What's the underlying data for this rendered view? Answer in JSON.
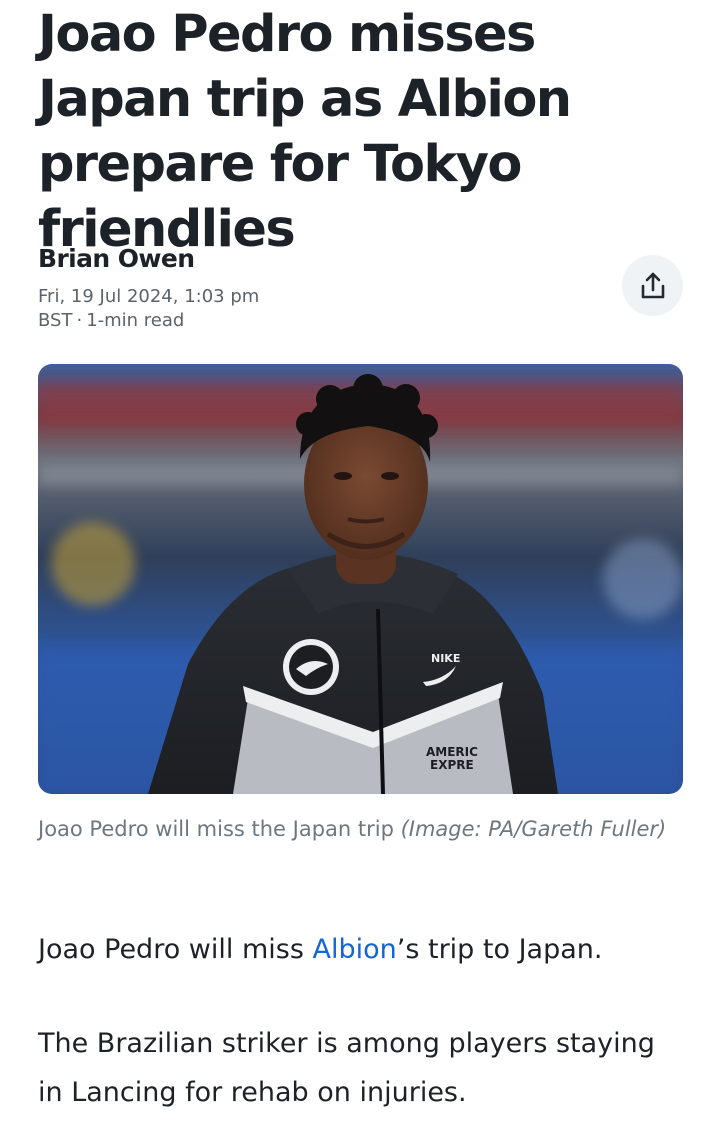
{
  "article": {
    "headline": "Joao Pedro misses Japan trip as Albion prepare for Tokyo friendlies",
    "author": "Brian Owen",
    "date": "Fri, 19 Jul 2024, 1:03 pm",
    "timezone": "BST",
    "read_time": "1-min read",
    "share_icon": "share-icon",
    "image": {
      "jacket_text_line1": "AMERIC",
      "jacket_text_line2": "EXPRE"
    },
    "caption": {
      "text": "Joao Pedro will miss the Japan trip ",
      "credit": "(Image: PA/Gareth Fuller)"
    },
    "paragraphs": {
      "p1_before": "Joao Pedro will miss ",
      "p1_link": "Albion",
      "p1_after": "’s trip to Japan.",
      "p2": "The Brazilian striker is among players staying in Lancing for rehab on injuries."
    },
    "colors": {
      "link": "#1465d6",
      "text": "#1d2228",
      "meta": "#5b636a",
      "caption": "#6e7780"
    }
  }
}
